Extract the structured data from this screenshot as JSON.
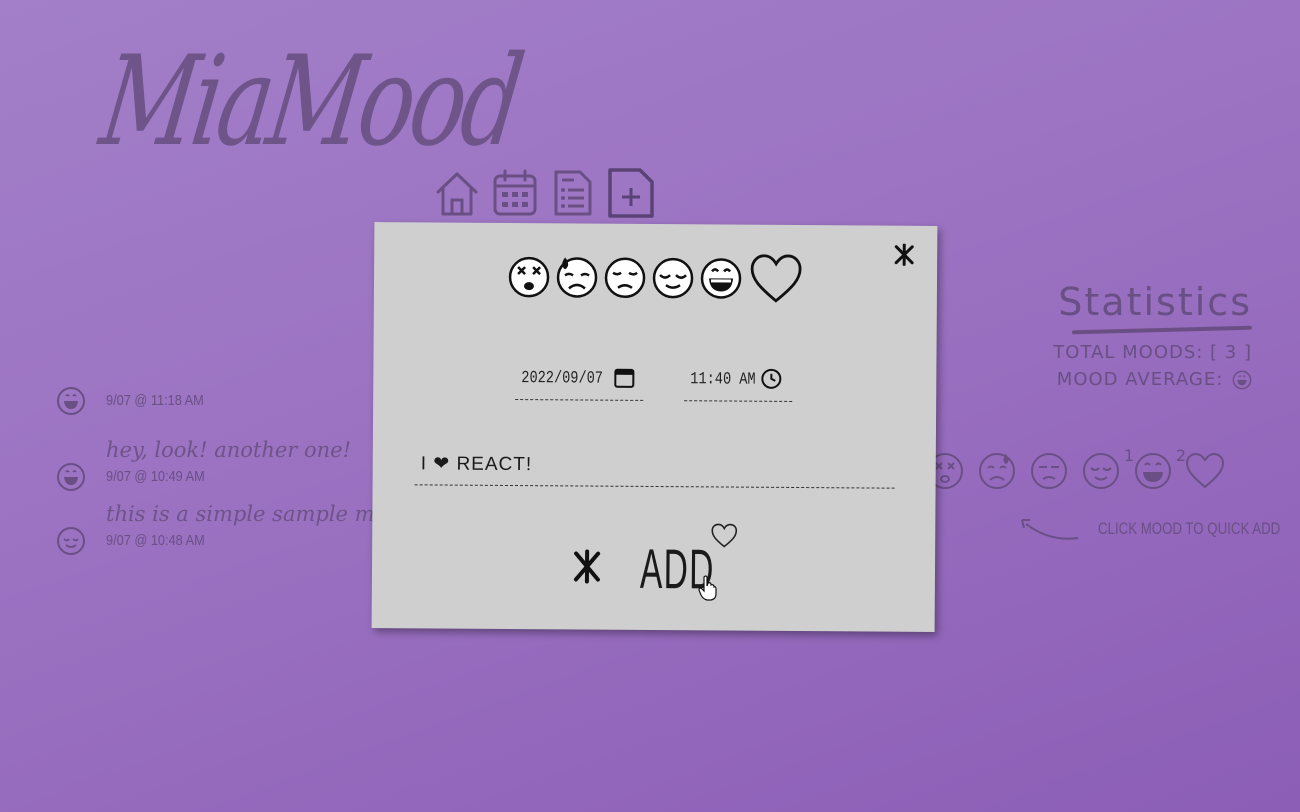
{
  "app": {
    "logo_text": "MiaMood"
  },
  "nav": {
    "items": [
      {
        "name": "home",
        "icon": "home-icon"
      },
      {
        "name": "calendar",
        "icon": "calendar-icon"
      },
      {
        "name": "list",
        "icon": "list-document-icon"
      },
      {
        "name": "add",
        "icon": "add-document-icon",
        "active": true
      }
    ]
  },
  "mood_list": [
    {
      "mood": "grinning",
      "note": "",
      "stamp": "9/07 @ 11:18 AM"
    },
    {
      "mood": "grinning",
      "note": "hey, look! another one!",
      "stamp": "9/07 @ 10:49 AM"
    },
    {
      "mood": "relieved",
      "note": "this is a simple sample mo",
      "stamp": "9/07 @ 10:48 AM"
    }
  ],
  "statistics": {
    "title": "Statistics",
    "total_label": "TOTAL MOODS: [ 3 ]",
    "average_label": "MOOD AVERAGE:",
    "average_mood": "grinning"
  },
  "quick_add": {
    "moods": [
      {
        "mood": "dizzy",
        "count": ""
      },
      {
        "mood": "sad-sweat",
        "count": ""
      },
      {
        "mood": "unamused",
        "count": ""
      },
      {
        "mood": "relieved",
        "count": "1"
      },
      {
        "mood": "grinning",
        "count": "2"
      },
      {
        "mood": "heart",
        "count": ""
      }
    ],
    "hint": "CLICK MOOD TO QUICK ADD"
  },
  "modal": {
    "moods": [
      "dizzy",
      "sad-sweat",
      "unamused",
      "relieved",
      "grinning",
      "heart"
    ],
    "date_value": "2022/09/07",
    "time_value": "11:40 AM",
    "note_value": "I ❤ REACT!",
    "add_label": "ADD"
  },
  "colors": {
    "background_start": "#a27fc8",
    "background_end": "#8c5eb6",
    "muted_purple": "#6a4f85",
    "modal_bg": "#cfcfcf",
    "ink": "#1a1a1a"
  }
}
